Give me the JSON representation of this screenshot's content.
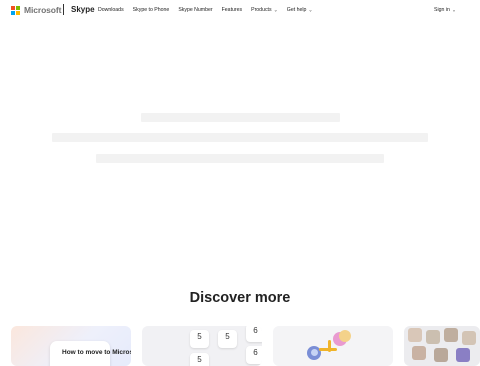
{
  "header": {
    "company": "Microsoft",
    "brand": "Skype",
    "nav": [
      {
        "label": "Downloads",
        "dropdown": false
      },
      {
        "label": "Skype to Phone",
        "dropdown": false
      },
      {
        "label": "Skype Number",
        "dropdown": false
      },
      {
        "label": "Features",
        "dropdown": false
      },
      {
        "label": "Products",
        "dropdown": true
      },
      {
        "label": "Get help",
        "dropdown": true
      }
    ],
    "signin": "Sign in"
  },
  "main": {
    "discover_title": "Discover more"
  },
  "cards": [
    {
      "text": "How to move to Microsoft"
    },
    {
      "keys": [
        "5",
        "5",
        "6",
        "5",
        "6"
      ]
    }
  ],
  "colors": {
    "ms_red": "#f25022",
    "ms_green": "#7fba00",
    "ms_blue": "#00a4ef",
    "ms_yellow": "#ffb900",
    "skeleton": "#f2f2f2"
  }
}
